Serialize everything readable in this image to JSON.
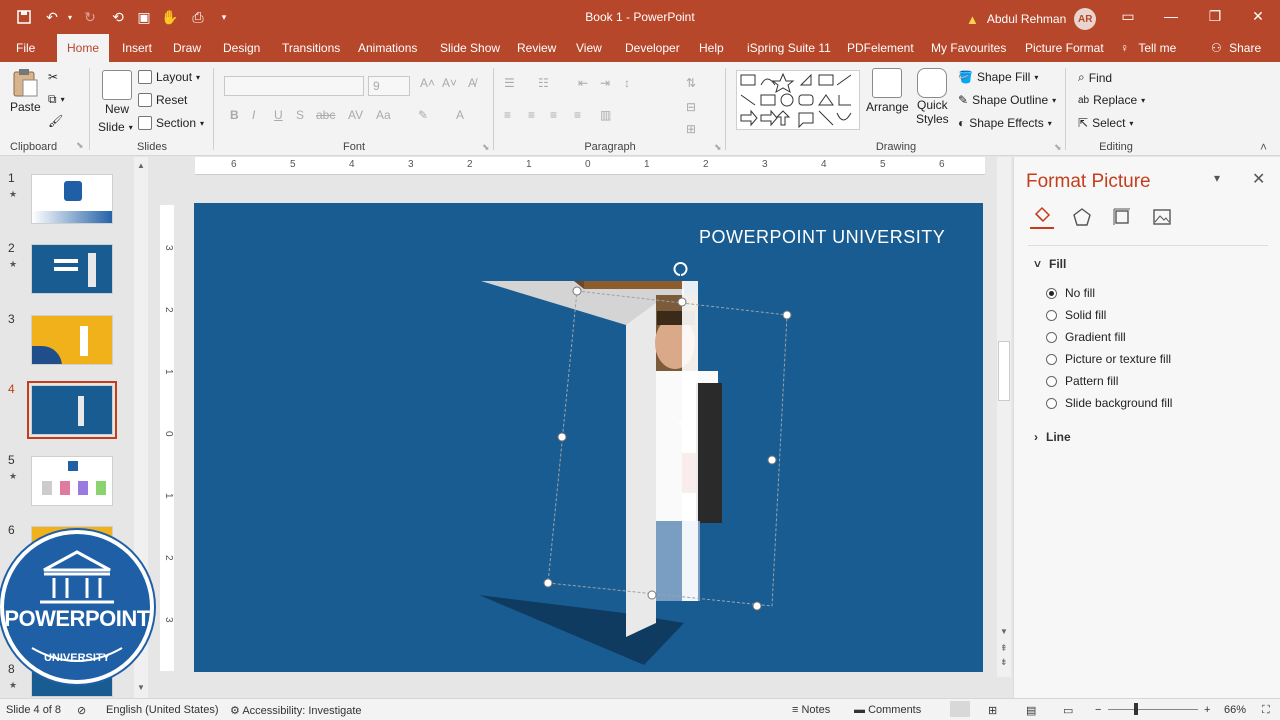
{
  "window": {
    "title": "Book 1  -  PowerPoint",
    "user_name": "Abdul Rehman",
    "user_initials": "AR"
  },
  "tabs": [
    "File",
    "Home",
    "Insert",
    "Draw",
    "Design",
    "Transitions",
    "Animations",
    "Slide Show",
    "Review",
    "View",
    "Developer",
    "Help",
    "iSpring Suite 11",
    "PDFelement",
    "My Favourites",
    "Picture Format"
  ],
  "tell_me": "Tell me",
  "share": "Share",
  "ribbon": {
    "clipboard": {
      "paste": "Paste",
      "label": "Clipboard"
    },
    "slides": {
      "new_slide_1": "New",
      "new_slide_2": "Slide",
      "layout": "Layout",
      "reset": "Reset",
      "section": "Section",
      "label": "Slides"
    },
    "font": {
      "size": "9",
      "label": "Font"
    },
    "paragraph": {
      "label": "Paragraph"
    },
    "drawing": {
      "arrange": "Arrange",
      "quick_styles_1": "Quick",
      "quick_styles_2": "Styles",
      "shape_fill": "Shape Fill",
      "shape_outline": "Shape Outline",
      "shape_effects": "Shape Effects",
      "label": "Drawing"
    },
    "editing": {
      "find": "Find",
      "replace": "Replace",
      "select": "Select",
      "label": "Editing"
    }
  },
  "thumbnails": [
    {
      "num": "1",
      "star": "★"
    },
    {
      "num": "2",
      "star": "★"
    },
    {
      "num": "3",
      "star": ""
    },
    {
      "num": "4",
      "star": ""
    },
    {
      "num": "5",
      "star": "★"
    },
    {
      "num": "6",
      "star": ""
    },
    {
      "num": "8",
      "star": "★"
    }
  ],
  "logo": {
    "line1": "POWERPOINT",
    "line2": "UNIVERSITY"
  },
  "slide": {
    "title": "POWERPOINT UNIVERSITY"
  },
  "ruler_h": [
    "6",
    "5",
    "4",
    "3",
    "2",
    "1",
    "0",
    "1",
    "2",
    "3",
    "4",
    "5",
    "6"
  ],
  "ruler_v": [
    "3",
    "2",
    "1",
    "0",
    "1",
    "2",
    "3"
  ],
  "pane": {
    "title": "Format Picture",
    "fill_header": "Fill",
    "fill_options": [
      "No fill",
      "Solid fill",
      "Gradient fill",
      "Picture or texture fill",
      "Pattern fill",
      "Slide background fill"
    ],
    "fill_selected_index": 0,
    "line_header": "Line"
  },
  "status": {
    "slide": "Slide 4 of 8",
    "language": "English (United States)",
    "accessibility": "Accessibility: Investigate",
    "notes": "Notes",
    "comments": "Comments",
    "zoom": "66%"
  },
  "colors": {
    "accent": "#b7472a",
    "slide_bg": "#195c92",
    "pane_title": "#c43e1c"
  }
}
